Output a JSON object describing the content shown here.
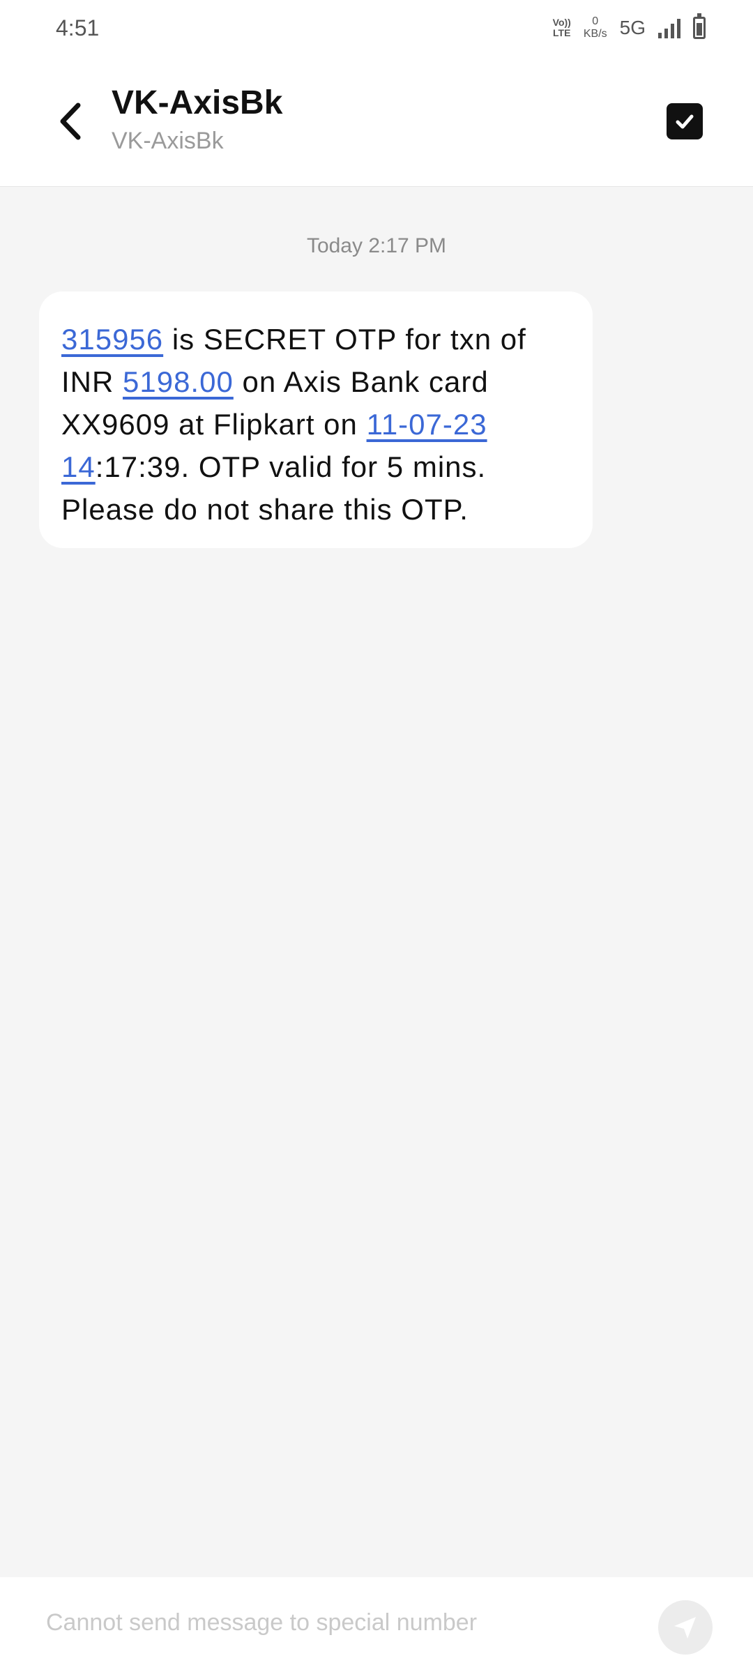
{
  "status_bar": {
    "time": "4:51",
    "volte_line1": "Vo))",
    "volte_line2": "LTE",
    "speed_value": "0",
    "speed_unit": "KB/s",
    "network": "5G"
  },
  "header": {
    "title": "VK-AxisBk",
    "subtitle": "VK-AxisBk"
  },
  "conversation": {
    "timestamp": "Today 2:17 PM",
    "message": {
      "otp": "315956",
      "t1": " is SECRET OTP for txn of INR ",
      "amount": "5198.00",
      "t2": " on Axis Bank card XX9609 at Flipkart on ",
      "date": "11-07-23 14",
      "t3": ":17:39. OTP valid for 5 mins. Please do not share this OTP."
    }
  },
  "composer": {
    "placeholder": "Cannot send message to special number"
  },
  "icons": {
    "back": "back-arrow-icon",
    "select": "checkbox-icon",
    "send": "send-icon"
  },
  "colors": {
    "link": "#3b68d6",
    "background": "#f5f5f5"
  }
}
